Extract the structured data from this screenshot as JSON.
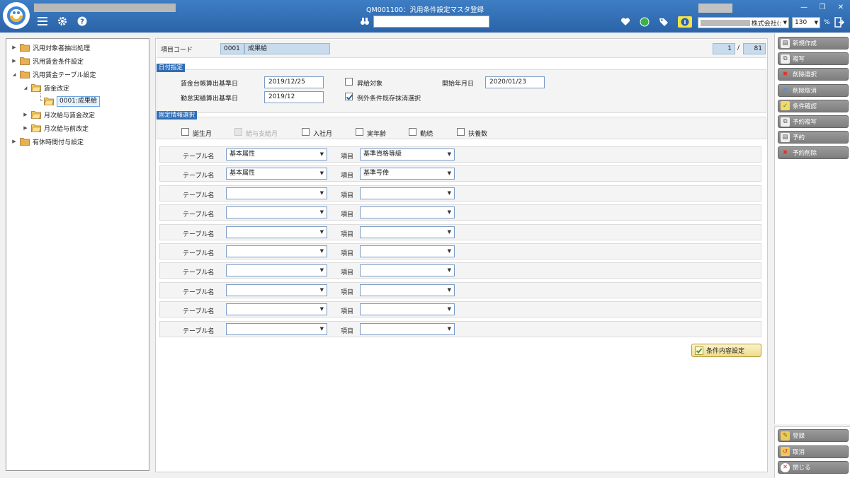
{
  "window": {
    "title": "QM001100：汎用条件設定マスタ登録",
    "zoom": "130",
    "zoom_unit": "%",
    "company_suffix": "株式会社(:"
  },
  "tree": [
    {
      "label": "汎用対象者抽出処理",
      "expanded": false
    },
    {
      "label": "汎用賃金条件設定",
      "expanded": false
    },
    {
      "label": "汎用賃金テーブル設定",
      "expanded": true
    },
    {
      "label": "賃金改定",
      "expanded": true
    },
    {
      "label": "0001:成果給",
      "selected": true
    },
    {
      "label": "月次給与賃金改定",
      "expanded": false
    },
    {
      "label": "月次給与前改定",
      "expanded": false
    },
    {
      "label": "有休時間付与設定",
      "expanded": false
    }
  ],
  "item_code": {
    "label": "項目コード",
    "code": "0001",
    "name": "成果給",
    "page_current": "1",
    "page_sep": "/",
    "page_total": "81"
  },
  "date_section": {
    "title": "日付指定",
    "wage_ledger_label": "賃金台帳算出基準日",
    "wage_ledger_value": "2019/12/25",
    "attendance_label": "勤怠実績算出基準日",
    "attendance_value": "2019/12",
    "promotion_label": "昇給対象",
    "exception_label": "例外条件既存抹消選択",
    "start_date_label": "開始年月日",
    "start_date_value": "2020/01/23"
  },
  "fixed_section": {
    "title": "固定情報選択",
    "checks": [
      {
        "label": "誕生月",
        "checked": false,
        "disabled": false
      },
      {
        "label": "給与支給月",
        "checked": false,
        "disabled": true
      },
      {
        "label": "入社月",
        "checked": false,
        "disabled": false
      },
      {
        "label": "実年齢",
        "checked": false,
        "disabled": false
      },
      {
        "label": "勤続",
        "checked": false,
        "disabled": false
      },
      {
        "label": "扶養数",
        "checked": false,
        "disabled": false
      }
    ]
  },
  "table_label": "テーブル名",
  "item_label": "項目",
  "rows": [
    {
      "table": "基本属性",
      "item": "基準資格等級"
    },
    {
      "table": "基本属性",
      "item": "基準号俸"
    },
    {
      "table": "",
      "item": ""
    },
    {
      "table": "",
      "item": ""
    },
    {
      "table": "",
      "item": ""
    },
    {
      "table": "",
      "item": ""
    },
    {
      "table": "",
      "item": ""
    },
    {
      "table": "",
      "item": ""
    },
    {
      "table": "",
      "item": ""
    },
    {
      "table": "",
      "item": ""
    }
  ],
  "apply_button": "条件内容設定",
  "commands": [
    "新規作成",
    "複写",
    "削除選択",
    "削除取消",
    "条件確認",
    "予約複写",
    "予約",
    "予約削除"
  ],
  "bottom_commands": [
    "登録",
    "取消",
    "閉じる"
  ],
  "colors": {
    "titlebar": "#2b63a8",
    "section": "#2f6db5",
    "button": "#8a8a8a"
  }
}
